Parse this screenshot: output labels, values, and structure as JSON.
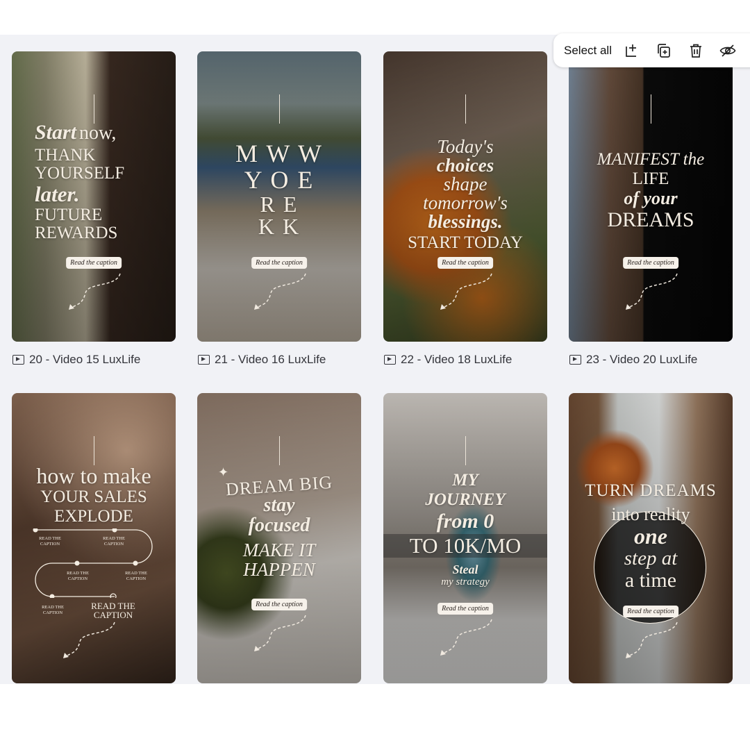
{
  "toolbar": {
    "select_all": "Select all",
    "icons": [
      "add-page-icon",
      "duplicate-icon",
      "trash-icon",
      "hide-icon"
    ]
  },
  "cards": [
    {
      "label": "20 - Video 15 LuxLife",
      "lines": [
        "Start",
        "now,",
        "THANK",
        "YOURSELF",
        "later.",
        "FUTURE",
        "REWARDS"
      ],
      "button": "Read the caption"
    },
    {
      "label": "21 - Video 16 LuxLife",
      "lines": [
        "M W W",
        "Y O E",
        "R E",
        "K K"
      ],
      "button": "Read the caption"
    },
    {
      "label": "22 - Video 18 LuxLife",
      "lines": [
        "Today's",
        "choices",
        "shape",
        "tomorrow's",
        "blessings.",
        "START TODAY"
      ],
      "button": "Read the caption"
    },
    {
      "label": "23 - Video 20 LuxLife",
      "lines": [
        "MANIFEST the",
        "LIFE",
        "of your",
        "DREAMS"
      ],
      "button": "Read the caption"
    },
    {
      "label": "",
      "lines": [
        "how to make",
        "YOUR SALES",
        "EXPLODE"
      ],
      "nodes": [
        "READ THE CAPTION",
        "READ THE CAPTION",
        "READ THE CAPTION",
        "READ THE CAPTION",
        "READ THE CAPTION",
        "READ THE CAPTION"
      ],
      "final": "READ THE CAPTION"
    },
    {
      "label": "",
      "lines": [
        "DREAM BIG",
        "stay",
        "focused",
        "MAKE IT",
        "HAPPEN"
      ],
      "button": "Read the caption"
    },
    {
      "label": "",
      "lines": [
        "MY",
        "JOURNEY",
        "from 0",
        "TO 10K/MO",
        "Steal",
        "my strategy"
      ],
      "button": "Read the caption"
    },
    {
      "label": "",
      "lines": [
        "TURN DREAMS",
        "into reality",
        "one",
        "step at",
        "a time"
      ],
      "button": "Read the caption"
    }
  ]
}
